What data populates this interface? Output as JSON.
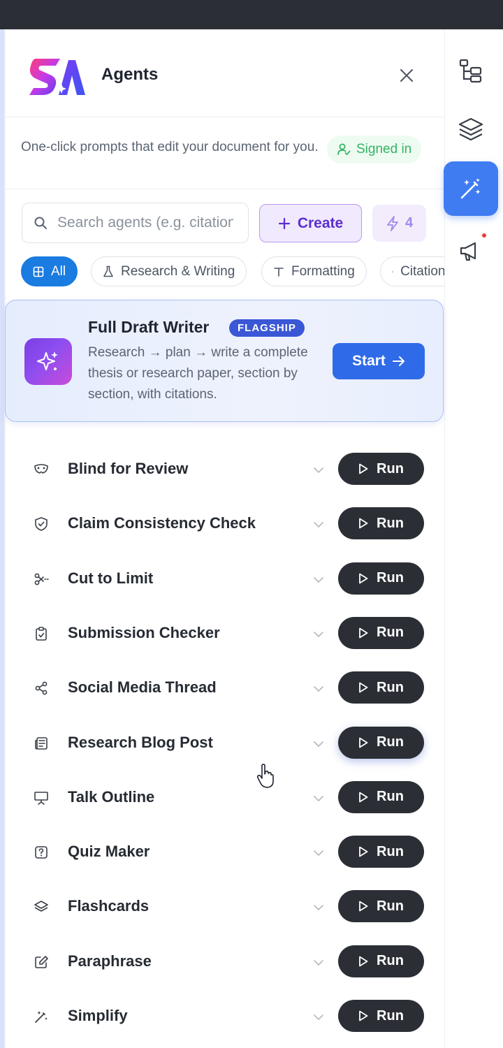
{
  "header": {
    "title": "Agents",
    "subtitle": "One-click prompts that edit your document for you.",
    "signed_in": "Signed in"
  },
  "toolbar": {
    "search_placeholder": "Search agents (e.g. citations, formatting)",
    "create_label": "Create",
    "credits": "4"
  },
  "filters": [
    "All",
    "Research & Writing",
    "Formatting",
    "Citations"
  ],
  "flagship": {
    "title": "Full Draft Writer",
    "badge": "FLAGSHIP",
    "description": "Research → plan → write a complete thesis or research paper, section by section, with citations.",
    "start_label": "Start"
  },
  "agents": [
    {
      "label": "Blind for Review",
      "icon": "mask-icon"
    },
    {
      "label": "Claim Consistency Check",
      "icon": "shield-check-icon"
    },
    {
      "label": "Cut to Limit",
      "icon": "scissors-icon"
    },
    {
      "label": "Submission Checker",
      "icon": "clipboard-check-icon"
    },
    {
      "label": "Social Media Thread",
      "icon": "share-icon"
    },
    {
      "label": "Research Blog Post",
      "icon": "newspaper-icon"
    },
    {
      "label": "Talk Outline",
      "icon": "presentation-icon"
    },
    {
      "label": "Quiz Maker",
      "icon": "question-icon"
    },
    {
      "label": "Flashcards",
      "icon": "layers-icon"
    },
    {
      "label": "Paraphrase",
      "icon": "edit-icon"
    },
    {
      "label": "Simplify",
      "icon": "wand-icon"
    }
  ],
  "run_label": "Run",
  "rail": [
    "outline-icon",
    "layers-icon",
    "magic-wand-icon",
    "megaphone-icon"
  ],
  "colors": {
    "accent": "#2f6be8",
    "create": "#5a2fd0",
    "run": "#2b2f35",
    "signed_in": "#32b464",
    "badge": "#3a57d6"
  }
}
